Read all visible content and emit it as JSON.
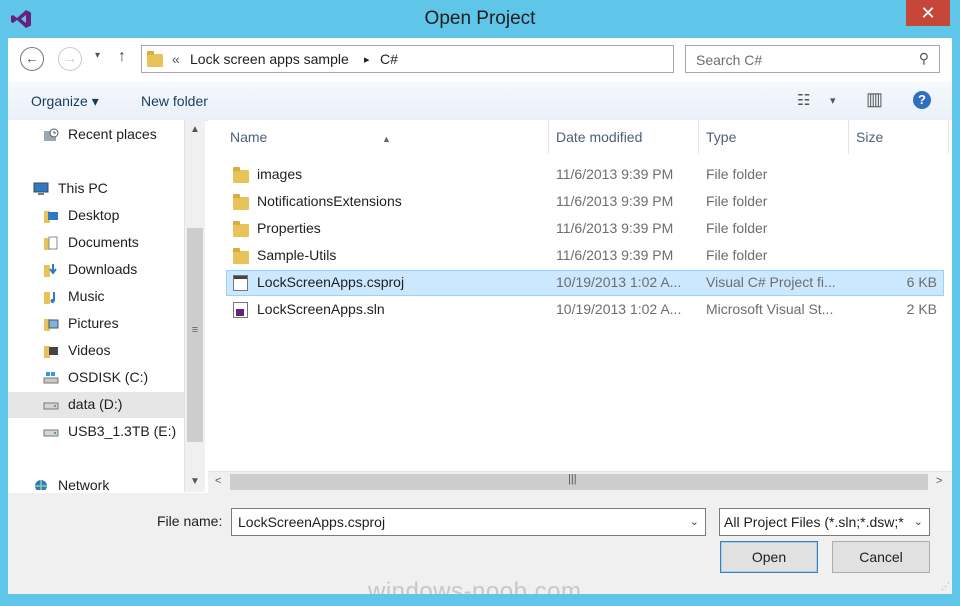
{
  "window": {
    "title": "Open Project",
    "accent": "#5fc6e9",
    "close_glyph": "✕",
    "app_icon": "visual-studio-icon"
  },
  "nav": {
    "back_glyph": "←",
    "forward_glyph": "→",
    "recent_glyph": "▾",
    "up_glyph": "↑"
  },
  "address": {
    "sep": "«",
    "crumbs": [
      "Lock screen apps sample",
      "C#"
    ],
    "arrow": "▸",
    "dropdown": "⌄",
    "refresh": "↻"
  },
  "search": {
    "placeholder": "Search C#",
    "icon": "⚲"
  },
  "toolbar": {
    "organize": "Organize ▾",
    "new_folder": "New folder",
    "view_glyph": "☷",
    "view_dd": "▾",
    "pane_glyph": "▥",
    "help": "?"
  },
  "sidebar": {
    "items": [
      {
        "label": "Recent places",
        "icon": "recent-places-icon"
      },
      {
        "label": "This PC",
        "icon": "computer-icon"
      },
      {
        "label": "Desktop",
        "icon": "desktop-folder-icon"
      },
      {
        "label": "Documents",
        "icon": "documents-folder-icon"
      },
      {
        "label": "Downloads",
        "icon": "downloads-folder-icon"
      },
      {
        "label": "Music",
        "icon": "music-folder-icon"
      },
      {
        "label": "Pictures",
        "icon": "pictures-folder-icon"
      },
      {
        "label": "Videos",
        "icon": "videos-folder-icon"
      },
      {
        "label": "OSDISK (C:)",
        "icon": "system-drive-icon"
      },
      {
        "label": "data (D:)",
        "icon": "drive-icon",
        "selected": true
      },
      {
        "label": "USB3_1.3TB (E:)",
        "icon": "drive-icon"
      },
      {
        "label": "Network",
        "icon": "network-icon"
      }
    ],
    "scroll_up": "▲",
    "scroll_down": "▼",
    "grip": "≡"
  },
  "files": {
    "columns": [
      "Name",
      "Date modified",
      "Type",
      "Size"
    ],
    "sort_glyph": "▲",
    "rows": [
      {
        "name": "images",
        "date": "11/6/2013 9:39 PM",
        "type": "File folder",
        "size": "",
        "kind": "folder"
      },
      {
        "name": "NotificationsExtensions",
        "date": "11/6/2013 9:39 PM",
        "type": "File folder",
        "size": "",
        "kind": "folder"
      },
      {
        "name": "Properties",
        "date": "11/6/2013 9:39 PM",
        "type": "File folder",
        "size": "",
        "kind": "folder"
      },
      {
        "name": "Sample-Utils",
        "date": "11/6/2013 9:39 PM",
        "type": "File folder",
        "size": "",
        "kind": "folder"
      },
      {
        "name": "LockScreenApps.csproj",
        "date": "10/19/2013 1:02 A...",
        "type": "Visual C# Project fi...",
        "size": "6 KB",
        "kind": "csproj",
        "selected": true
      },
      {
        "name": "LockScreenApps.sln",
        "date": "10/19/2013 1:02 A...",
        "type": "Microsoft Visual St...",
        "size": "2 KB",
        "kind": "sln"
      }
    ],
    "hscroll_left": "<",
    "hscroll_right": ">",
    "hscroll_grip": "|||"
  },
  "bottom": {
    "file_name_label": "File name:",
    "file_name_value": "LockScreenApps.csproj",
    "dropdown_glyph": "⌄",
    "filter_value": "All Project Files (*.sln;*.dsw;*",
    "open_label": "Open",
    "cancel_label": "Cancel",
    "watermark": "windows-noob.com",
    "resize_glyph": "⋰"
  }
}
